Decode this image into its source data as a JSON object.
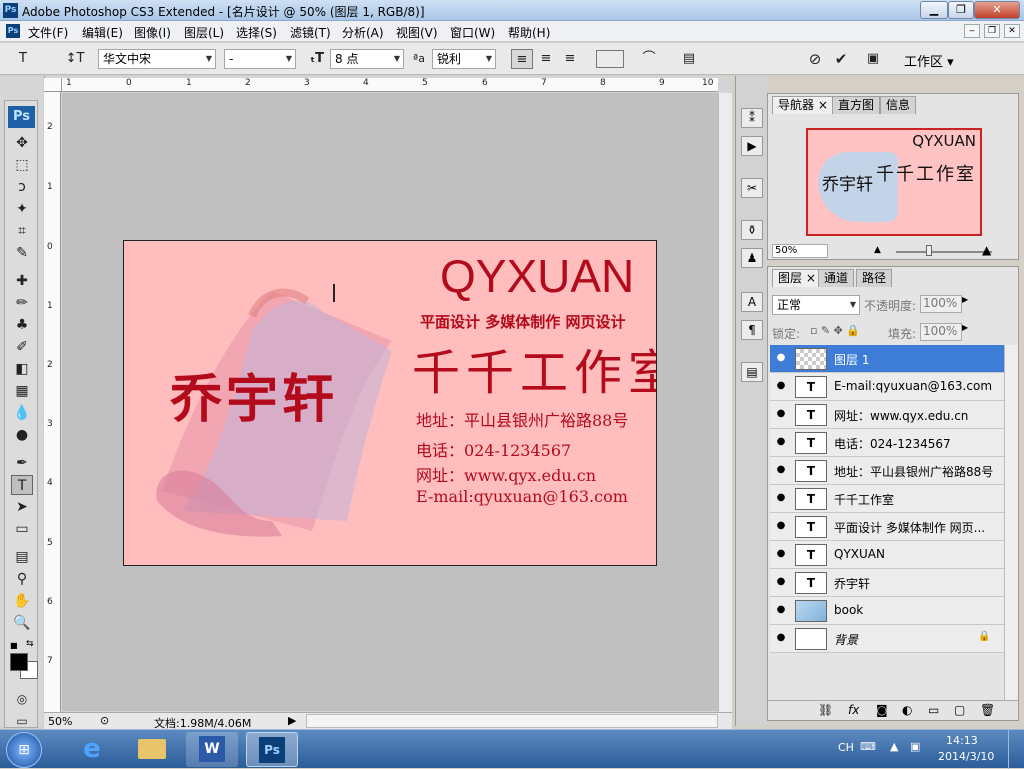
{
  "window": {
    "title": "Adobe Photoshop CS3 Extended - [名片设计 @ 50% (图层 1, RGB/8)]",
    "app_icon": "Ps"
  },
  "menu": [
    "文件(F)",
    "编辑(E)",
    "图像(I)",
    "图层(L)",
    "选择(S)",
    "滤镜(T)",
    "分析(A)",
    "视图(V)",
    "窗口(W)",
    "帮助(H)"
  ],
  "options": {
    "font_family": "华文中宋",
    "font_style": "-",
    "font_size": "8 点",
    "aa_label": "ªa",
    "antialias": "锐利",
    "workspace": "工作区"
  },
  "rulers": {
    "h": [
      "1",
      "0",
      "1",
      "2",
      "3",
      "4",
      "5",
      "6",
      "7",
      "8",
      "9",
      "10"
    ],
    "v": [
      "2",
      "1",
      "0",
      "1",
      "2",
      "3",
      "4",
      "5",
      "6",
      "7"
    ]
  },
  "card": {
    "brand": "QYXUAN",
    "slogan": "平面设计 多媒体制作 网页设计",
    "studio": "千千工作室",
    "name": "乔宇轩",
    "address": "地址：平山县银州广裕路88号",
    "phone": "电话：024-1234567",
    "web": "网址：www.qyx.edu.cn",
    "email": "E-mail:qyuxuan@163.com"
  },
  "status": {
    "zoom": "50%",
    "doc": "文档:1.98M/4.06M"
  },
  "navigator": {
    "tabs": [
      "导航器",
      "直方图",
      "信息"
    ],
    "zoom": "50%"
  },
  "layers_panel": {
    "tabs": [
      "图层",
      "通道",
      "路径"
    ],
    "blend_mode": "正常",
    "opacity_label": "不透明度:",
    "opacity": "100%",
    "lock_label": "锁定:",
    "fill_label": "填充:",
    "fill": "100%",
    "layers": [
      {
        "name": "图层 1",
        "type": "raster",
        "selected": true
      },
      {
        "name": "E-mail:qyuxuan@163.com",
        "type": "text"
      },
      {
        "name": "网址：www.qyx.edu.cn",
        "type": "text"
      },
      {
        "name": "电话：024-1234567",
        "type": "text"
      },
      {
        "name": "地址：平山县银州广裕路88号",
        "type": "text"
      },
      {
        "name": "千千工作室",
        "type": "text"
      },
      {
        "name": "平面设计 多媒体制作 网页...",
        "type": "text"
      },
      {
        "name": "QYXUAN",
        "type": "text"
      },
      {
        "name": "乔宇轩",
        "type": "text"
      },
      {
        "name": "book",
        "type": "smart"
      },
      {
        "name": "背景",
        "type": "background"
      }
    ]
  },
  "taskbar": {
    "lang": "CH",
    "time": "14:13",
    "date": "2014/3/10",
    "ps_label": "Ps"
  },
  "colors": {
    "card_bg": "#ffbdbd",
    "card_text": "#b30b1b",
    "selected_layer": "#3d7dd8"
  }
}
